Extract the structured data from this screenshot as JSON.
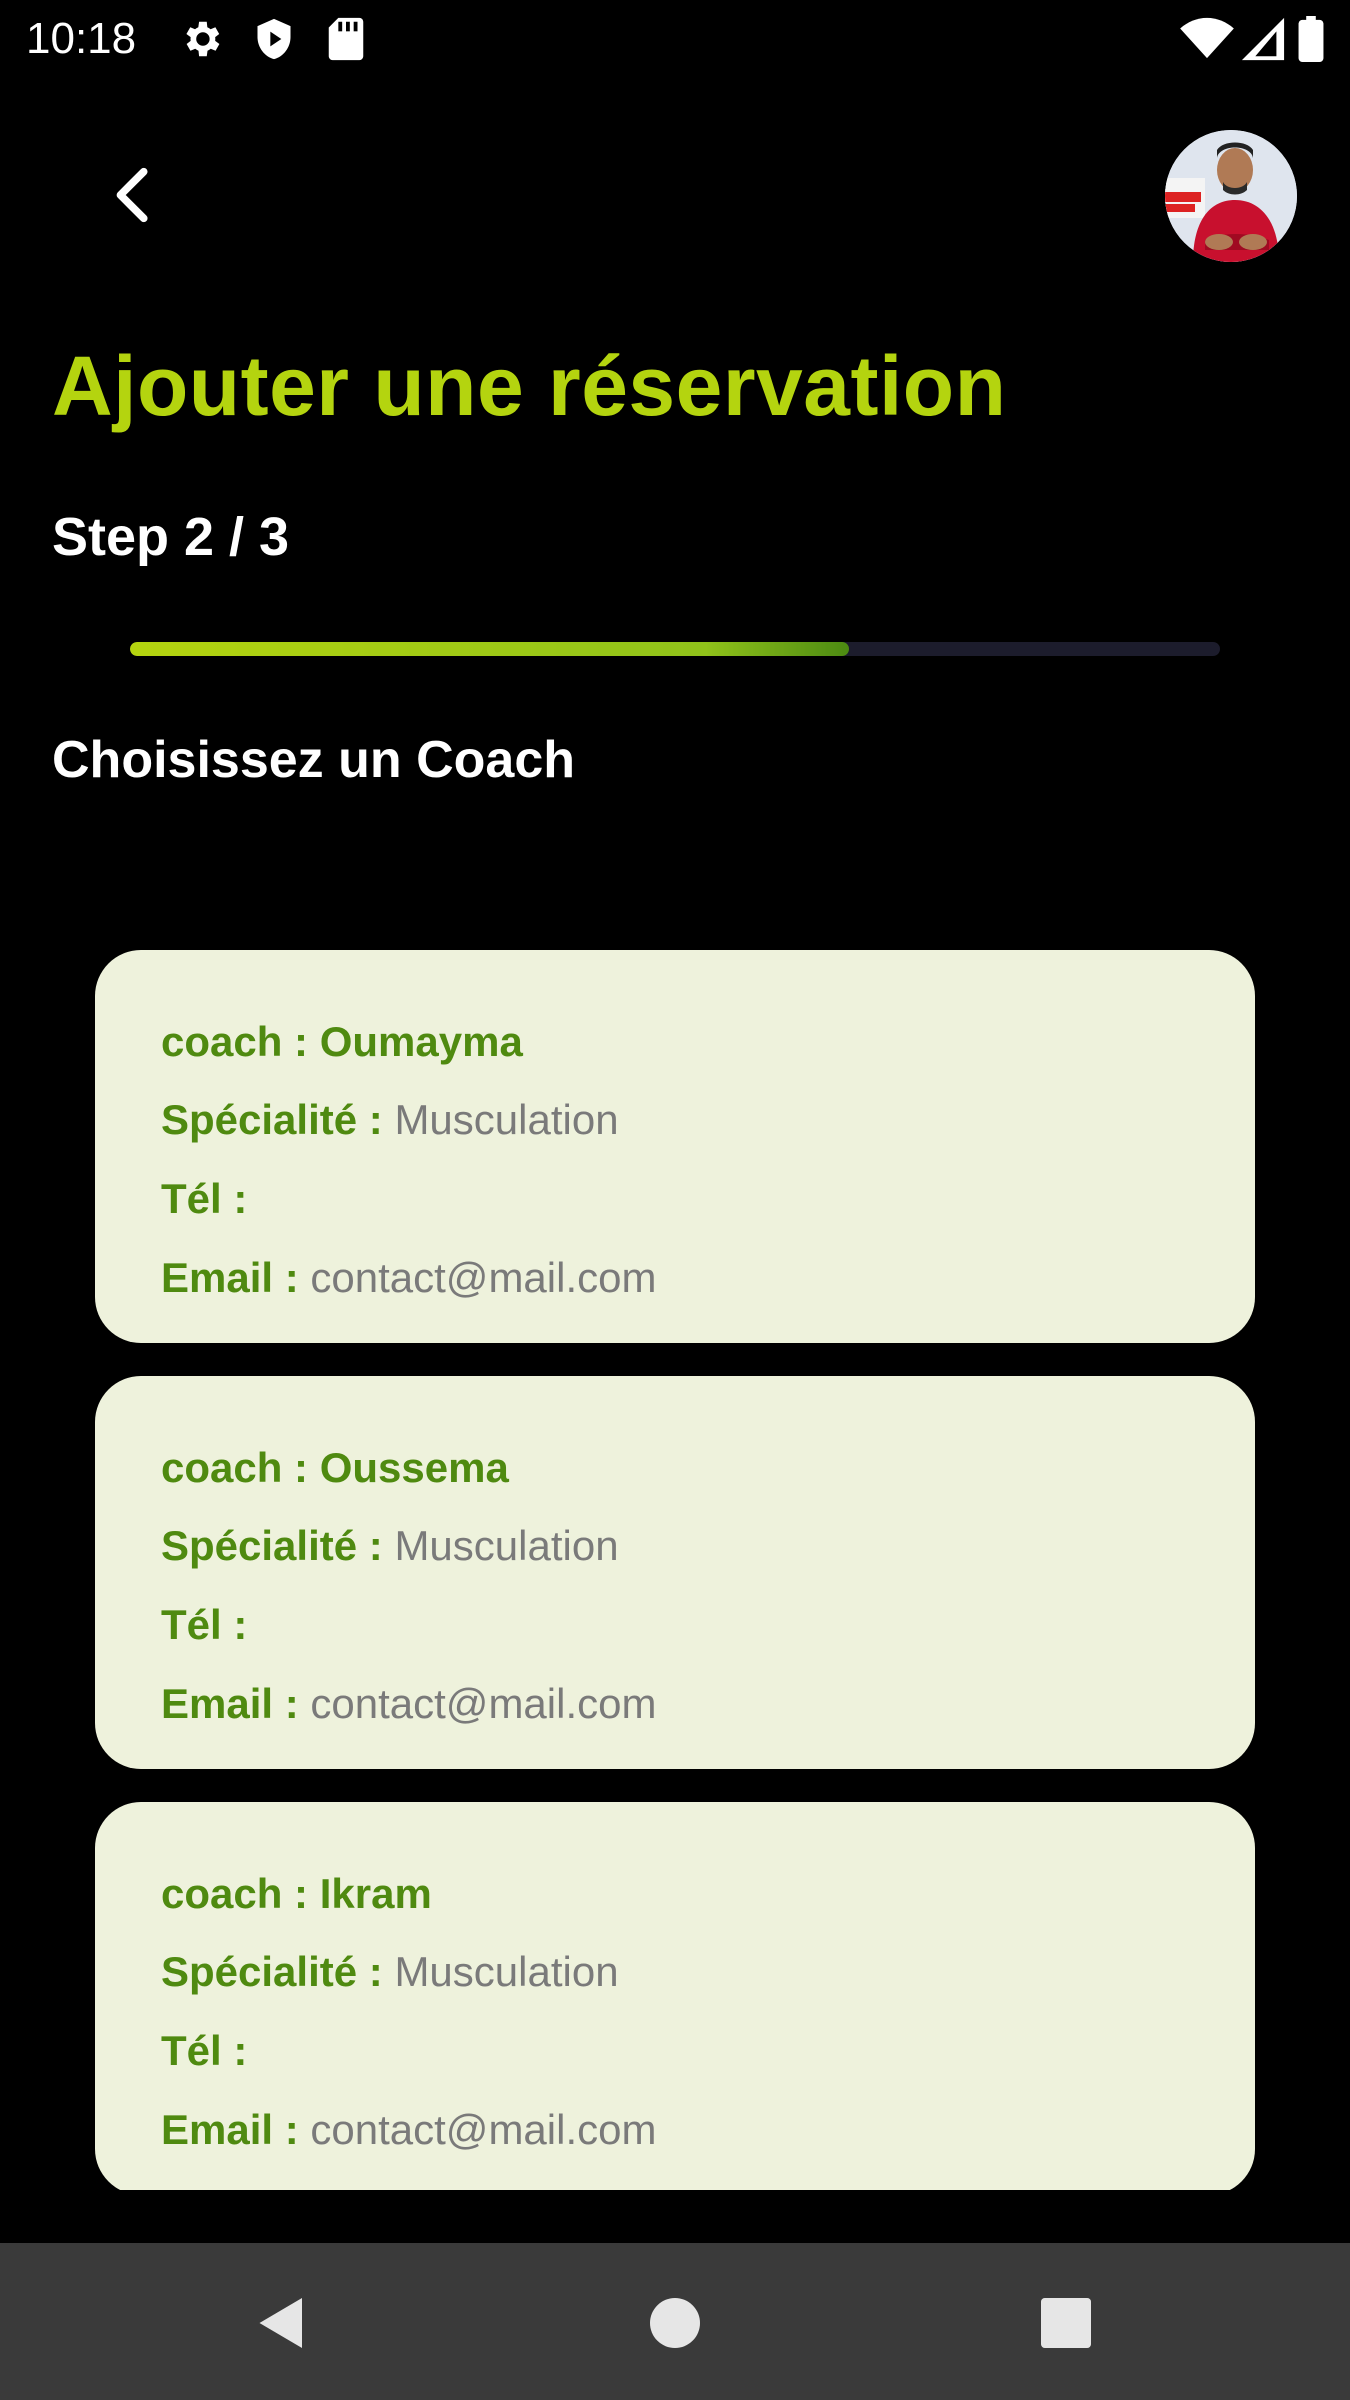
{
  "status_bar": {
    "time": "10:18",
    "icons_left": [
      "gear-icon",
      "shield-play-icon",
      "sd-card-icon"
    ],
    "icons_right": [
      "wifi-icon",
      "cellular-signal-icon",
      "battery-icon"
    ]
  },
  "header": {
    "back_icon": "chevron-left-icon",
    "avatar_alt": "user-avatar"
  },
  "page": {
    "title": "Ajouter une réservation",
    "step": "Step 2 / 3",
    "progress_fraction": 0.66,
    "section_title": "Choisissez un Coach"
  },
  "coaches": [
    {
      "name_label": "coach : Oumayma",
      "specialty_label": "Spécialité :",
      "specialty": "Musculation",
      "phone_label": "Tél :",
      "phone": "",
      "email_label": "Email :",
      "email": "contact@mail.com"
    },
    {
      "name_label": "coach : Oussema",
      "specialty_label": "Spécialité :",
      "specialty": "Musculation",
      "phone_label": "Tél :",
      "phone": "",
      "email_label": "Email :",
      "email": "contact@mail.com"
    },
    {
      "name_label": "coach : Ikram",
      "specialty_label": "Spécialité :",
      "specialty": "Musculation",
      "phone_label": "Tél :",
      "phone": "",
      "email_label": "Email :",
      "email": "contact@mail.com"
    }
  ],
  "colors": {
    "accent": "#b4d40f",
    "card_bg": "#eef2dc",
    "label_green": "#4f8a10",
    "background": "#000000"
  },
  "nav_bar": {
    "buttons": [
      "back-triangle-icon",
      "home-circle-icon",
      "recents-square-icon"
    ]
  }
}
